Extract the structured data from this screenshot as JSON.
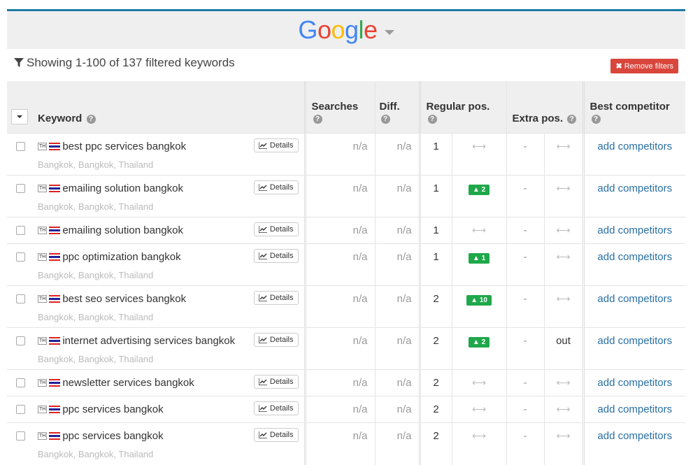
{
  "brand": {
    "letters": [
      {
        "ch": "G",
        "color": "#4285F4"
      },
      {
        "ch": "o",
        "color": "#EA4335"
      },
      {
        "ch": "o",
        "color": "#FBBC05"
      },
      {
        "ch": "g",
        "color": "#4285F4"
      },
      {
        "ch": "l",
        "color": "#34A853"
      },
      {
        "ch": "e",
        "color": "#EA4335"
      }
    ]
  },
  "filter": {
    "text": "Showing 1-100 of 137 filtered keywords",
    "remove_label": "Remove filters"
  },
  "columns": {
    "keyword": "Keyword",
    "searches": "Searches",
    "diff": "Diff.",
    "regular": "Regular pos.",
    "extra": "Extra pos.",
    "competitor": "Best competitor"
  },
  "details_label": "Details",
  "country_code": "TH",
  "rows": [
    {
      "keyword": "best ppc services bangkok",
      "location": "Bangkok, Bangkok, Thailand",
      "searches": "n/a",
      "diff": "n/a",
      "pos": "1",
      "change": "",
      "extra": "-",
      "extra_change": "",
      "competitor": "add competitors"
    },
    {
      "keyword": "emailing solution bangkok",
      "location": "Bangkok, Bangkok, Thailand",
      "searches": "n/a",
      "diff": "n/a",
      "pos": "1",
      "change": "2",
      "extra": "-",
      "extra_change": "",
      "competitor": "add competitors"
    },
    {
      "keyword": "emailing solution bangkok",
      "location": "",
      "searches": "n/a",
      "diff": "n/a",
      "pos": "1",
      "change": "",
      "extra": "-",
      "extra_change": "",
      "competitor": "add competitors"
    },
    {
      "keyword": "ppc optimization bangkok",
      "location": "Bangkok, Bangkok, Thailand",
      "searches": "n/a",
      "diff": "n/a",
      "pos": "1",
      "change": "1",
      "extra": "-",
      "extra_change": "",
      "competitor": "add competitors"
    },
    {
      "keyword": "best seo services bangkok",
      "location": "Bangkok, Bangkok, Thailand",
      "searches": "n/a",
      "diff": "n/a",
      "pos": "2",
      "change": "10",
      "extra": "-",
      "extra_change": "",
      "competitor": "add competitors"
    },
    {
      "keyword": "internet advertising services bangkok",
      "location": "Bangkok, Bangkok, Thailand",
      "searches": "n/a",
      "diff": "n/a",
      "pos": "2",
      "change": "2",
      "extra": "-",
      "extra_change": "out",
      "competitor": "add competitors"
    },
    {
      "keyword": "newsletter services bangkok",
      "location": "",
      "searches": "n/a",
      "diff": "n/a",
      "pos": "2",
      "change": "",
      "extra": "-",
      "extra_change": "",
      "competitor": "add competitors"
    },
    {
      "keyword": "ppc services bangkok",
      "location": "",
      "searches": "n/a",
      "diff": "n/a",
      "pos": "2",
      "change": "",
      "extra": "-",
      "extra_change": "",
      "competitor": "add competitors"
    },
    {
      "keyword": "ppc services bangkok",
      "location": "Bangkok, Bangkok, Thailand",
      "searches": "n/a",
      "diff": "n/a",
      "pos": "2",
      "change": "",
      "extra": "-",
      "extra_change": "",
      "competitor": "add competitors"
    }
  ]
}
